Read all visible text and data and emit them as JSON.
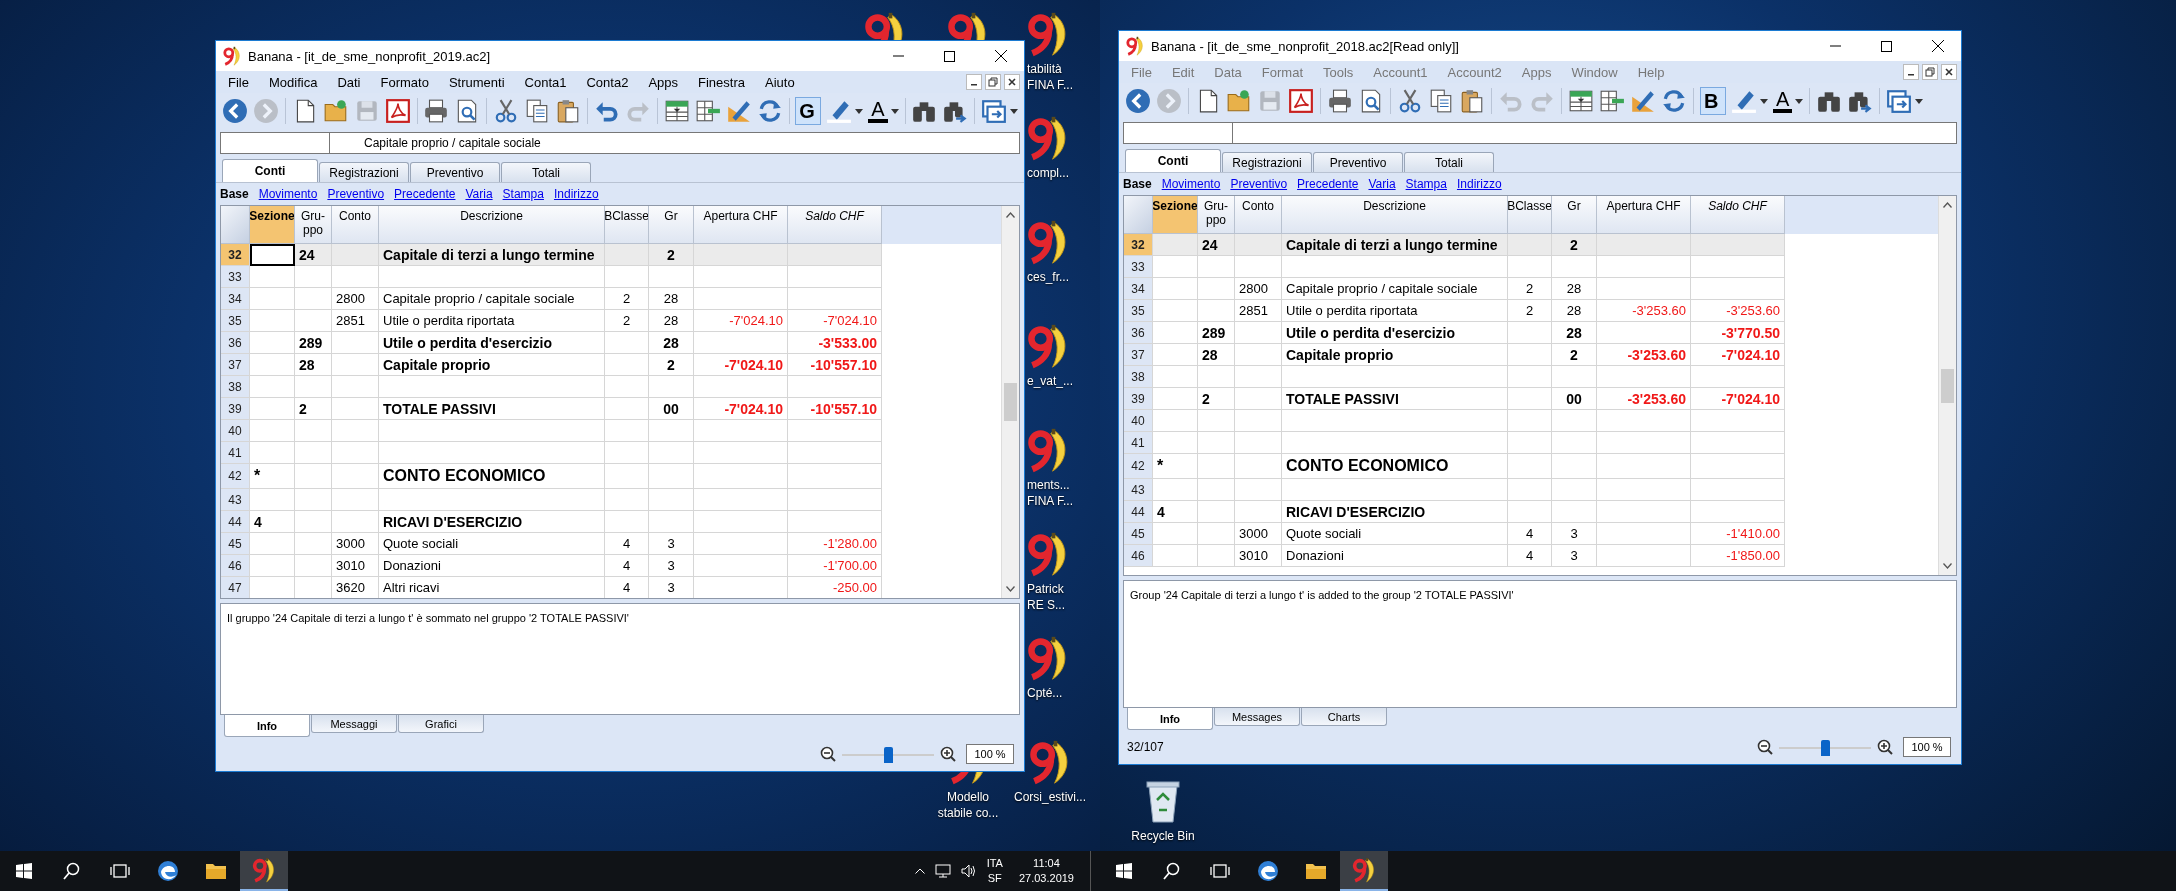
{
  "screens": [
    {
      "window": {
        "title": "Banana - [it_de_sme_nonprofit_2019.ac2]",
        "active": true,
        "menu": [
          "File",
          "Modifica",
          "Dati",
          "Formato",
          "Strumenti",
          "Conta1",
          "Conta2",
          "Apps",
          "Finestra",
          "Aiuto"
        ],
        "toolbar": [
          {
            "kind": "back",
            "disabled": false
          },
          {
            "kind": "forward",
            "disabled": true
          },
          {
            "kind": "new",
            "disabled": false
          },
          {
            "kind": "open",
            "disabled": false
          },
          {
            "kind": "save",
            "disabled": true
          },
          {
            "kind": "pdf",
            "disabled": false
          },
          {
            "kind": "print",
            "disabled": false
          },
          {
            "kind": "preview",
            "disabled": false
          },
          {
            "kind": "cut",
            "disabled": false
          },
          {
            "kind": "copy",
            "disabled": false
          },
          {
            "kind": "paste",
            "disabled": false
          },
          {
            "kind": "undo",
            "disabled": false
          },
          {
            "kind": "redo",
            "disabled": true
          },
          {
            "kind": "insert_rows",
            "disabled": false
          },
          {
            "kind": "remove_rows",
            "disabled": false
          },
          {
            "kind": "edit",
            "disabled": false
          },
          {
            "kind": "refresh",
            "disabled": false
          },
          {
            "kind": "bold",
            "label": "G",
            "selected": true
          },
          {
            "kind": "highlight",
            "disabled": false
          },
          {
            "kind": "font_color",
            "label": "A"
          },
          {
            "kind": "find",
            "disabled": false
          },
          {
            "kind": "find_next",
            "disabled": false
          },
          {
            "kind": "windows",
            "disabled": false
          }
        ],
        "cell_content": "Capitale proprio / capitale sociale",
        "tabs": [
          {
            "label": "Conti",
            "selected": true
          },
          {
            "label": "Registrazioni",
            "selected": false
          },
          {
            "label": "Preventivo",
            "selected": false
          },
          {
            "label": "Totali",
            "selected": false
          }
        ],
        "views": [
          {
            "label": "Base",
            "selected": true
          },
          {
            "label": "Movimento",
            "selected": false
          },
          {
            "label": "Preventivo",
            "selected": false
          },
          {
            "label": "Precedente",
            "selected": false
          },
          {
            "label": "Varia",
            "selected": false
          },
          {
            "label": "Stampa",
            "selected": false
          },
          {
            "label": "Indirizzo",
            "selected": false
          }
        ],
        "columns": [
          {
            "label": "Sezione",
            "kind": "text",
            "selected": true,
            "italic": false
          },
          {
            "label": "Gru-ppo",
            "kind": "text",
            "selected": false,
            "italic": false
          },
          {
            "label": "Conto",
            "kind": "text",
            "selected": false,
            "italic": false
          },
          {
            "label": "Descrizione",
            "kind": "text",
            "selected": false,
            "italic": false
          },
          {
            "label": "BClasse",
            "kind": "class",
            "selected": false,
            "italic": false
          },
          {
            "label": "Gr",
            "kind": "class",
            "selected": false,
            "italic": false
          },
          {
            "label": "Apertura CHF",
            "kind": "amount",
            "selected": false,
            "italic": false
          },
          {
            "label": "Saldo CHF",
            "kind": "amount",
            "selected": false,
            "italic": true
          }
        ],
        "rows": [
          {
            "num": "32",
            "kind": "group",
            "selected": true,
            "cells": [
              null,
              "24",
              null,
              "Capitale di terzi a lungo termine",
              null,
              "2",
              null,
              null
            ]
          },
          {
            "num": "33",
            "kind": "blank",
            "selected": false
          },
          {
            "num": "34",
            "kind": "account",
            "selected": false,
            "cells": [
              null,
              null,
              "2800",
              "Capitale proprio / capitale sociale",
              "2",
              "28",
              null,
              null
            ]
          },
          {
            "num": "35",
            "kind": "account",
            "selected": false,
            "cells": [
              null,
              null,
              "2851",
              "Utile o perdita riportata",
              "2",
              "28",
              "-7'024.10",
              "-7'024.10"
            ]
          },
          {
            "num": "36",
            "kind": "group",
            "selected": false,
            "cells": [
              null,
              "289",
              null,
              "Utile o perdita d'esercizio",
              null,
              "28",
              null,
              "-3'533.00"
            ]
          },
          {
            "num": "37",
            "kind": "group",
            "selected": false,
            "cells": [
              null,
              "28",
              null,
              "Capitale proprio",
              null,
              "2",
              "-7'024.10",
              "-10'557.10"
            ]
          },
          {
            "num": "38",
            "kind": "blank",
            "selected": false
          },
          {
            "num": "39",
            "kind": "group",
            "selected": false,
            "cells": [
              null,
              "2",
              null,
              "TOTALE PASSIVI",
              null,
              "00",
              "-7'024.10",
              "-10'557.10"
            ]
          },
          {
            "num": "40",
            "kind": "blank",
            "selected": false
          },
          {
            "num": "41",
            "kind": "blank",
            "selected": false
          },
          {
            "num": "42",
            "kind": "title",
            "selected": false,
            "cells": [
              "*",
              null,
              null,
              "CONTO ECONOMICO",
              null,
              null,
              null,
              null
            ]
          },
          {
            "num": "43",
            "kind": "blank",
            "selected": false
          },
          {
            "num": "44",
            "kind": "group",
            "selected": false,
            "cells": [
              "4",
              null,
              null,
              "RICAVI D'ESERCIZIO",
              null,
              null,
              null,
              null
            ]
          },
          {
            "num": "45",
            "kind": "account",
            "selected": false,
            "cells": [
              null,
              null,
              "3000",
              "Quote sociali",
              "4",
              "3",
              null,
              "-1'280.00"
            ]
          },
          {
            "num": "46",
            "kind": "account",
            "selected": false,
            "cells": [
              null,
              null,
              "3010",
              "Donazioni",
              "4",
              "3",
              null,
              "-1'700.00"
            ]
          },
          {
            "num": "47",
            "kind": "account",
            "selected": false,
            "cells": [
              null,
              null,
              "3620",
              "Altri ricavi",
              "4",
              "3",
              null,
              "-250.00"
            ]
          }
        ],
        "info": "Il gruppo '24 Capitale di terzi a lungo t' è sommato nel gruppo '2 TOTALE PASSIVI'",
        "bottom_tabs": [
          {
            "label": "Info",
            "selected": true
          },
          {
            "label": "Messaggi",
            "selected": false
          },
          {
            "label": "Grafici",
            "selected": false
          }
        ],
        "zoom_slider": {
          "level": 0.5
        },
        "zoom_value": "100 %"
      },
      "desktop_icons": [
        {
          "kind": "banana"
        },
        {
          "kind": "banana"
        },
        {
          "kind": "banana",
          "label": [
            "tabilità",
            "FINA F..."
          ]
        },
        {
          "kind": "banana",
          "label": [
            "compl..."
          ]
        },
        {
          "kind": "banana",
          "label": [
            "ces_fr..."
          ]
        },
        {
          "kind": "banana",
          "label": [
            "e_vat_..."
          ]
        },
        {
          "kind": "banana",
          "label": [
            "ments...",
            "FINA F..."
          ]
        },
        {
          "kind": "banana",
          "label": [
            "Patrick",
            "RE S..."
          ]
        },
        {
          "kind": "banana",
          "label": [
            "Cpté..."
          ]
        },
        {
          "kind": "banana",
          "label": [
            "Modello",
            "stabile co..."
          ]
        },
        {
          "kind": "banana",
          "label": [
            "Corsi_estivi..."
          ]
        }
      ],
      "taskbar": {
        "apps": [
          {
            "kind": "start",
            "active": false
          },
          {
            "kind": "search",
            "active": false
          },
          {
            "kind": "task_view",
            "active": false
          },
          {
            "kind": "browser",
            "active": false
          },
          {
            "kind": "folder",
            "active": false
          },
          {
            "kind": "banana",
            "active": true
          }
        ],
        "tray": {
          "language": "ITA",
          "layout": "SF",
          "time": "11:04",
          "date": "27.03.2019"
        }
      }
    },
    {
      "window": {
        "title": "Banana - [it_de_sme_nonprofit_2018.ac2[Read only]]",
        "active": false,
        "menu": [
          "File",
          "Edit",
          "Data",
          "Format",
          "Tools",
          "Account1",
          "Account2",
          "Apps",
          "Window",
          "Help"
        ],
        "toolbar": [
          {
            "kind": "back",
            "disabled": false
          },
          {
            "kind": "forward",
            "disabled": true
          },
          {
            "kind": "new",
            "disabled": false
          },
          {
            "kind": "open",
            "disabled": false
          },
          {
            "kind": "save",
            "disabled": true
          },
          {
            "kind": "pdf",
            "disabled": false
          },
          {
            "kind": "print",
            "disabled": false
          },
          {
            "kind": "preview",
            "disabled": false
          },
          {
            "kind": "cut",
            "disabled": false
          },
          {
            "kind": "copy",
            "disabled": false
          },
          {
            "kind": "paste",
            "disabled": false
          },
          {
            "kind": "undo",
            "disabled": true
          },
          {
            "kind": "redo",
            "disabled": true
          },
          {
            "kind": "insert_rows",
            "disabled": false
          },
          {
            "kind": "remove_rows",
            "disabled": false
          },
          {
            "kind": "edit",
            "disabled": false
          },
          {
            "kind": "refresh",
            "disabled": false
          },
          {
            "kind": "bold",
            "label": "B",
            "selected": true
          },
          {
            "kind": "highlight",
            "disabled": false
          },
          {
            "kind": "font_color",
            "label": "A"
          },
          {
            "kind": "find",
            "disabled": false
          },
          {
            "kind": "find_next",
            "disabled": false
          },
          {
            "kind": "windows",
            "disabled": false
          }
        ],
        "tabs": [
          {
            "label": "Conti",
            "selected": true
          },
          {
            "label": "Registrazioni",
            "selected": false
          },
          {
            "label": "Preventivo",
            "selected": false
          },
          {
            "label": "Totali",
            "selected": false
          }
        ],
        "views": [
          {
            "label": "Base",
            "selected": true
          },
          {
            "label": "Movimento",
            "selected": false
          },
          {
            "label": "Preventivo",
            "selected": false
          },
          {
            "label": "Precedente",
            "selected": false
          },
          {
            "label": "Varia",
            "selected": false
          },
          {
            "label": "Stampa",
            "selected": false
          },
          {
            "label": "Indirizzo",
            "selected": false
          }
        ],
        "columns": [
          {
            "label": "Sezione",
            "kind": "text",
            "selected": true,
            "italic": false
          },
          {
            "label": "Gru-ppo",
            "kind": "text",
            "selected": false,
            "italic": false
          },
          {
            "label": "Conto",
            "kind": "text",
            "selected": false,
            "italic": false
          },
          {
            "label": "Descrizione",
            "kind": "text",
            "selected": false,
            "italic": false
          },
          {
            "label": "BClasse",
            "kind": "class",
            "selected": false,
            "italic": false
          },
          {
            "label": "Gr",
            "kind": "class",
            "selected": false,
            "italic": false
          },
          {
            "label": "Apertura CHF",
            "kind": "amount",
            "selected": false,
            "italic": false
          },
          {
            "label": "Saldo CHF",
            "kind": "amount",
            "selected": false,
            "italic": true
          }
        ],
        "rows": [
          {
            "num": "32",
            "kind": "group",
            "selected": true,
            "cells": [
              null,
              "24",
              null,
              "Capitale di terzi a lungo termine",
              null,
              "2",
              null,
              null
            ]
          },
          {
            "num": "33",
            "kind": "blank",
            "selected": false
          },
          {
            "num": "34",
            "kind": "account",
            "selected": false,
            "cells": [
              null,
              null,
              "2800",
              "Capitale proprio / capitale sociale",
              "2",
              "28",
              null,
              null
            ]
          },
          {
            "num": "35",
            "kind": "account",
            "selected": false,
            "cells": [
              null,
              null,
              "2851",
              "Utile o perdita riportata",
              "2",
              "28",
              "-3'253.60",
              "-3'253.60"
            ]
          },
          {
            "num": "36",
            "kind": "group",
            "selected": false,
            "cells": [
              null,
              "289",
              null,
              "Utile o perdita d'esercizio",
              null,
              "28",
              null,
              "-3'770.50"
            ]
          },
          {
            "num": "37",
            "kind": "group",
            "selected": false,
            "cells": [
              null,
              "28",
              null,
              "Capitale proprio",
              null,
              "2",
              "-3'253.60",
              "-7'024.10"
            ]
          },
          {
            "num": "38",
            "kind": "blank",
            "selected": false
          },
          {
            "num": "39",
            "kind": "group",
            "selected": false,
            "cells": [
              null,
              "2",
              null,
              "TOTALE PASSIVI",
              null,
              "00",
              "-3'253.60",
              "-7'024.10"
            ]
          },
          {
            "num": "40",
            "kind": "blank",
            "selected": false
          },
          {
            "num": "41",
            "kind": "blank",
            "selected": false
          },
          {
            "num": "42",
            "kind": "title",
            "selected": false,
            "cells": [
              "*",
              null,
              null,
              "CONTO ECONOMICO",
              null,
              null,
              null,
              null
            ]
          },
          {
            "num": "43",
            "kind": "blank",
            "selected": false
          },
          {
            "num": "44",
            "kind": "group",
            "selected": false,
            "cells": [
              "4",
              null,
              null,
              "RICAVI D'ESERCIZIO",
              null,
              null,
              null,
              null
            ]
          },
          {
            "num": "45",
            "kind": "account",
            "selected": false,
            "cells": [
              null,
              null,
              "3000",
              "Quote sociali",
              "4",
              "3",
              null,
              "-1'410.00"
            ]
          },
          {
            "num": "46",
            "kind": "account",
            "selected": false,
            "cells": [
              null,
              null,
              "3010",
              "Donazioni",
              "4",
              "3",
              null,
              "-1'850.00"
            ]
          }
        ],
        "info": "Group '24 Capitale di terzi a lungo t' is added to the group '2 TOTALE PASSIVI'",
        "bottom_tabs": [
          {
            "label": "Info",
            "selected": true
          },
          {
            "label": "Messages",
            "selected": false
          },
          {
            "label": "Charts",
            "selected": false
          }
        ],
        "status": "32/107",
        "zoom_slider": {
          "level": 0.5
        },
        "zoom_value": "100 %"
      },
      "desktop_icons": [
        {
          "kind": "recycle_bin",
          "label": [
            "Recycle Bin"
          ]
        }
      ],
      "taskbar": {
        "apps": [
          {
            "kind": "start",
            "active": false
          },
          {
            "kind": "search",
            "active": false
          },
          {
            "kind": "task_view",
            "active": false
          },
          {
            "kind": "browser",
            "active": false
          },
          {
            "kind": "folder",
            "active": false
          },
          {
            "kind": "banana",
            "active": true
          }
        ]
      }
    }
  ]
}
